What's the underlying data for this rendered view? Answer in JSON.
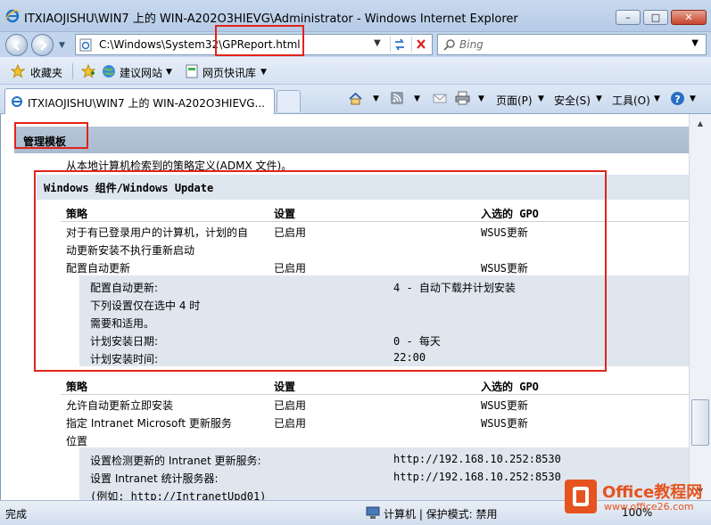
{
  "window": {
    "title": "ITXIAOJISHU\\WIN7 上的 WIN-A202O3HIEVG\\Administrator - Windows Internet Explorer",
    "min": "–",
    "max": "□",
    "close": "✕"
  },
  "address": {
    "url": "C:\\Windows\\System32\\GPReport.html",
    "search_placeholder": "Bing"
  },
  "favorites": {
    "label": "收藏夹",
    "items": [
      {
        "label": "建议网站",
        "icon": "globe-icon"
      },
      {
        "label": "网页快讯库",
        "icon": "web-slice-icon"
      }
    ]
  },
  "tab": {
    "title": "ITXIAOJISHU\\WIN7 上的 WIN-A202O3HIEVG..."
  },
  "commands": {
    "page": "页面(P)",
    "safety": "安全(S)",
    "tools": "工具(O)"
  },
  "report": {
    "section": "管理模板",
    "section_desc": "从本地计算机检索到的策略定义(ADMX 文件)。",
    "category": "Windows 组件/Windows Update",
    "headers": {
      "policy": "策略",
      "setting": "设置",
      "gpo": "入选的 GPO"
    },
    "block1": [
      {
        "policy": [
          "对于有已登录用户的计算机，计划的自",
          "动更新安装不执行重新启动"
        ],
        "setting": "已启用",
        "gpo": "WSUS更新"
      },
      {
        "policy": [
          "配置自动更新"
        ],
        "setting": "已启用",
        "gpo": "WSUS更新"
      }
    ],
    "block1_details": [
      {
        "label": "配置自动更新:",
        "value": "4 - 自动下载并计划安装"
      },
      {
        "label": "下列设置仅在选中 4 时",
        "value": ""
      },
      {
        "label": "需要和适用。",
        "value": ""
      },
      {
        "label": "计划安装日期:",
        "value": "0 - 每天"
      },
      {
        "label": "计划安装时间:",
        "value": "22:00"
      }
    ],
    "block2": [
      {
        "policy": [
          "允许自动更新立即安装"
        ],
        "setting": "已启用",
        "gpo": "WSUS更新"
      },
      {
        "policy": [
          "指定 Intranet Microsoft 更新服务",
          "位置"
        ],
        "setting": "已启用",
        "gpo": "WSUS更新"
      }
    ],
    "block2_details": [
      {
        "label": "设置检测更新的 Intranet 更新服务:",
        "value": "http://192.168.10.252:8530"
      },
      {
        "label": "设置 Intranet 统计服务器:",
        "value": "http://192.168.10.252:8530"
      },
      {
        "label": "(例如: http://IntranetUpd01)",
        "value": ""
      }
    ]
  },
  "status": {
    "left": "完成",
    "zone": "计算机 | 保护模式: 禁用",
    "zoom": "100%"
  },
  "watermark": {
    "title": "Office教程网",
    "url": "www.office26.com"
  }
}
